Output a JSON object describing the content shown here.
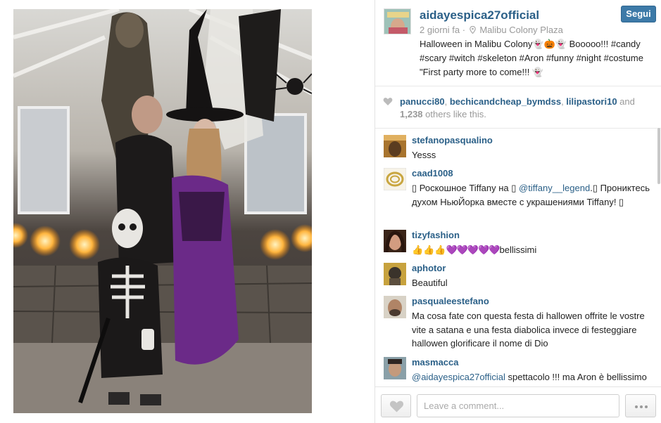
{
  "post": {
    "username": "aidayespica27official",
    "follow_label": "Segui",
    "time_ago": "2 giorni fa",
    "separator": "·",
    "location": "Malibu Colony Plaza",
    "caption": "Halloween in Malibu Colony👻🎃👻 Booooo!!! #candy #scary #witch #skeleton #Aron #funny #night #costume \"First party more to come!!! 👻"
  },
  "likes": {
    "users": [
      "panucci80",
      "bechicandcheap_bymdss",
      "lilipastori10"
    ],
    "sep": ", ",
    "and_label": " and",
    "count": "1,238",
    "suffix": " others like this."
  },
  "comments": [
    {
      "user": "stefanopasqualino",
      "text": "Yesss"
    },
    {
      "user": "caad1008",
      "text_parts": [
        "▯ Роскошное Tiffany на ▯ ",
        "@tiffany__legend",
        ".▯ Прониктесь духом НьюЙорка вместе с украшениями Tiffany! ▯"
      ]
    },
    {
      "user": "tizyfashion",
      "text_parts": [
        "👍👍👍",
        "💜💜💜💜💜",
        "bellissimi"
      ]
    },
    {
      "user": "aphotor",
      "text": "Beautiful"
    },
    {
      "user": "pasqualeestefano",
      "text": "Ma cosa fate con questa festa di hallowen offrite le vostre vite a satana e una festa diabolica invece di festeggiare hallowen glorificare il nome di Dio"
    },
    {
      "user": "masmacca",
      "text_parts": [
        "@aidayespica27official",
        " spettacolo !!! ma Aron è ",
        "bellissimo"
      ]
    }
  ],
  "footer": {
    "comment_placeholder": "Leave a comment..."
  },
  "icons": {
    "location": "location-pin-icon",
    "heart": "heart-icon",
    "more": "more-dots-icon"
  },
  "colors": {
    "username_blue": "#2b6088",
    "follow_button": "#3d7aa8",
    "muted_text": "#999999"
  }
}
